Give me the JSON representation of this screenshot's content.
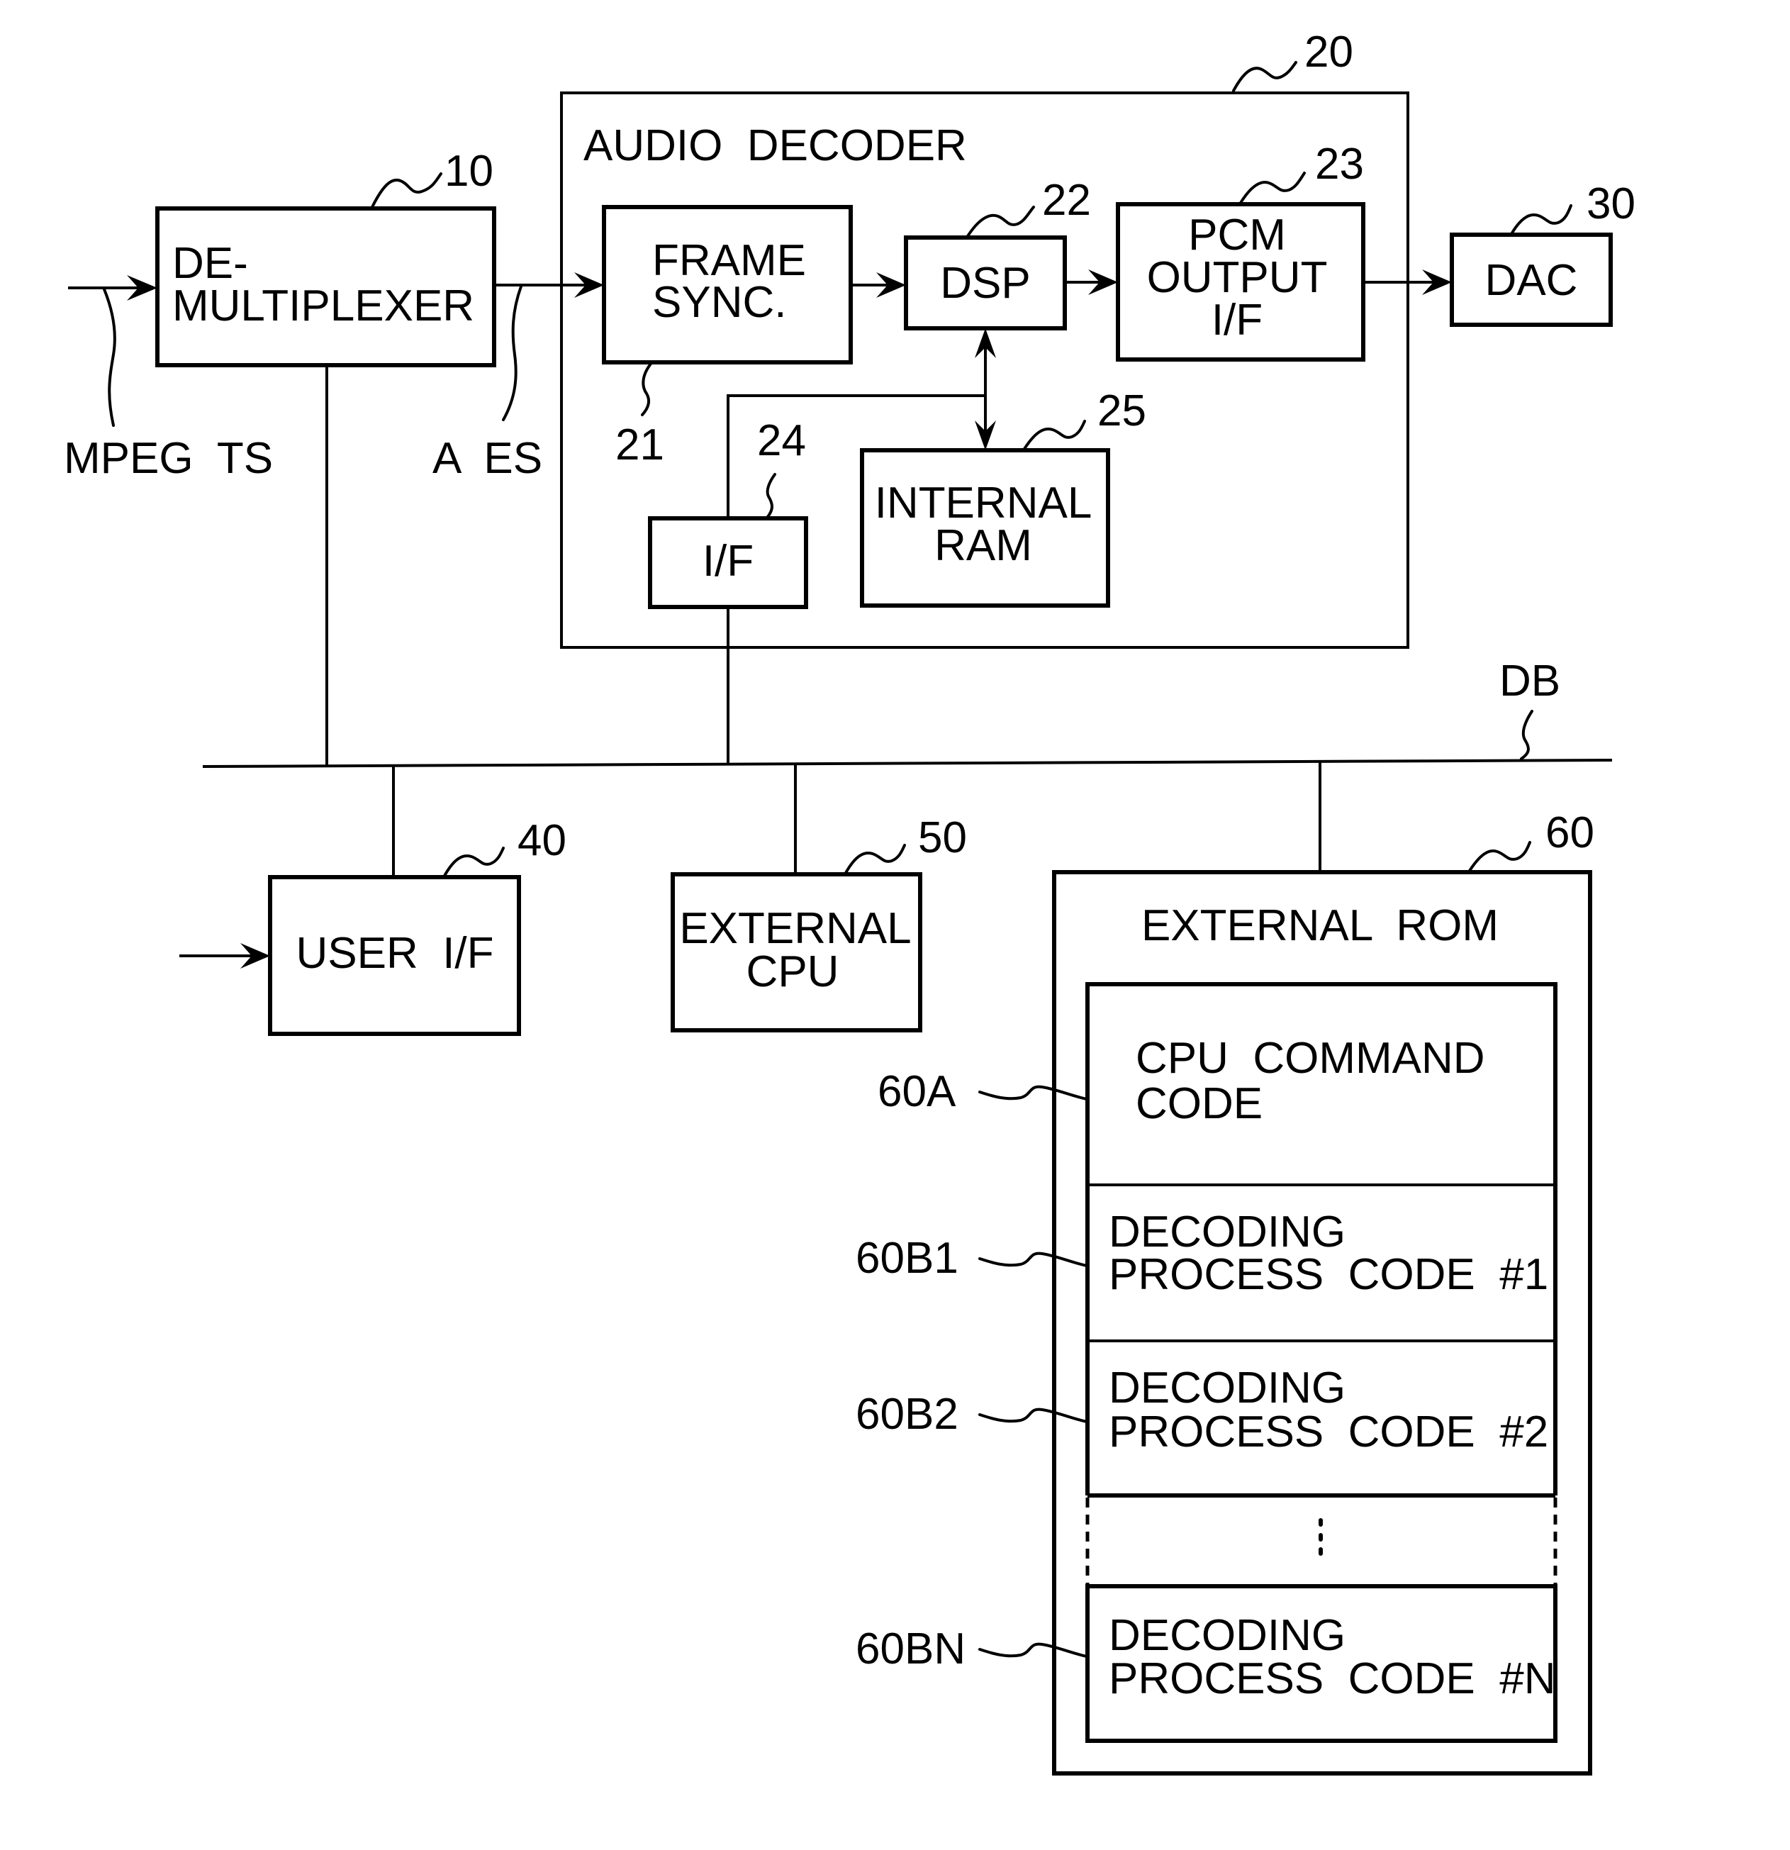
{
  "diagram": {
    "type": "block-diagram",
    "blocks": {
      "demux": {
        "ref": "10",
        "lines": [
          "DE-",
          "MULTIPLEXER"
        ]
      },
      "audio_decoder": {
        "ref": "20",
        "title": "AUDIO  DECODER"
      },
      "frame_sync": {
        "ref": "21",
        "lines": [
          "FRAME",
          "SYNC."
        ]
      },
      "dsp": {
        "ref": "22",
        "lines": [
          "DSP"
        ]
      },
      "pcm_output": {
        "ref": "23",
        "lines": [
          "PCM",
          "OUTPUT",
          "I/F"
        ]
      },
      "interface": {
        "ref": "24",
        "lines": [
          "I/F"
        ]
      },
      "internal_ram": {
        "ref": "25",
        "lines": [
          "INTERNAL",
          "RAM"
        ]
      },
      "dac": {
        "ref": "30",
        "lines": [
          "DAC"
        ]
      },
      "user_if": {
        "ref": "40",
        "lines": [
          "USER  I/F"
        ]
      },
      "external_cpu": {
        "ref": "50",
        "lines": [
          "EXTERNAL",
          "CPU"
        ]
      },
      "external_rom": {
        "ref": "60",
        "title": "EXTERNAL  ROM",
        "sections": [
          {
            "ref": "60A",
            "lines": [
              "CPU  COMMAND",
              "CODE"
            ]
          },
          {
            "ref": "60B1",
            "lines": [
              "DECODING",
              "PROCESS  CODE  #1"
            ]
          },
          {
            "ref": "60B2",
            "lines": [
              "DECODING",
              "PROCESS  CODE  #2"
            ]
          },
          {
            "ref": "",
            "lines": [
              "⋮"
            ]
          },
          {
            "ref": "60BN",
            "lines": [
              "DECODING",
              "PROCESS  CODE  #N"
            ]
          }
        ]
      }
    },
    "signals": {
      "input": "MPEG  TS",
      "audio_es": "A  ES",
      "bus": "DB"
    },
    "connections": [
      {
        "from": "MPEG TS input",
        "to": "demux",
        "arrow": true
      },
      {
        "from": "demux",
        "to": "frame_sync",
        "arrow": true
      },
      {
        "from": "frame_sync",
        "to": "dsp",
        "arrow": true
      },
      {
        "from": "dsp",
        "to": "pcm_output",
        "arrow": true
      },
      {
        "from": "pcm_output",
        "to": "dac",
        "arrow": true
      },
      {
        "from": "dsp",
        "to": "internal_ram",
        "arrow": "both"
      },
      {
        "from": "interface",
        "to": "dsp/internal_ram line",
        "arrow": false
      },
      {
        "from": "demux",
        "to": "DB",
        "arrow": false
      },
      {
        "from": "interface",
        "to": "DB",
        "arrow": false
      },
      {
        "from": "user_if",
        "to": "DB",
        "arrow": false
      },
      {
        "from": "external_cpu",
        "to": "DB",
        "arrow": false
      },
      {
        "from": "external_rom",
        "to": "DB",
        "arrow": false
      },
      {
        "from": "external input",
        "to": "user_if",
        "arrow": true
      }
    ]
  }
}
